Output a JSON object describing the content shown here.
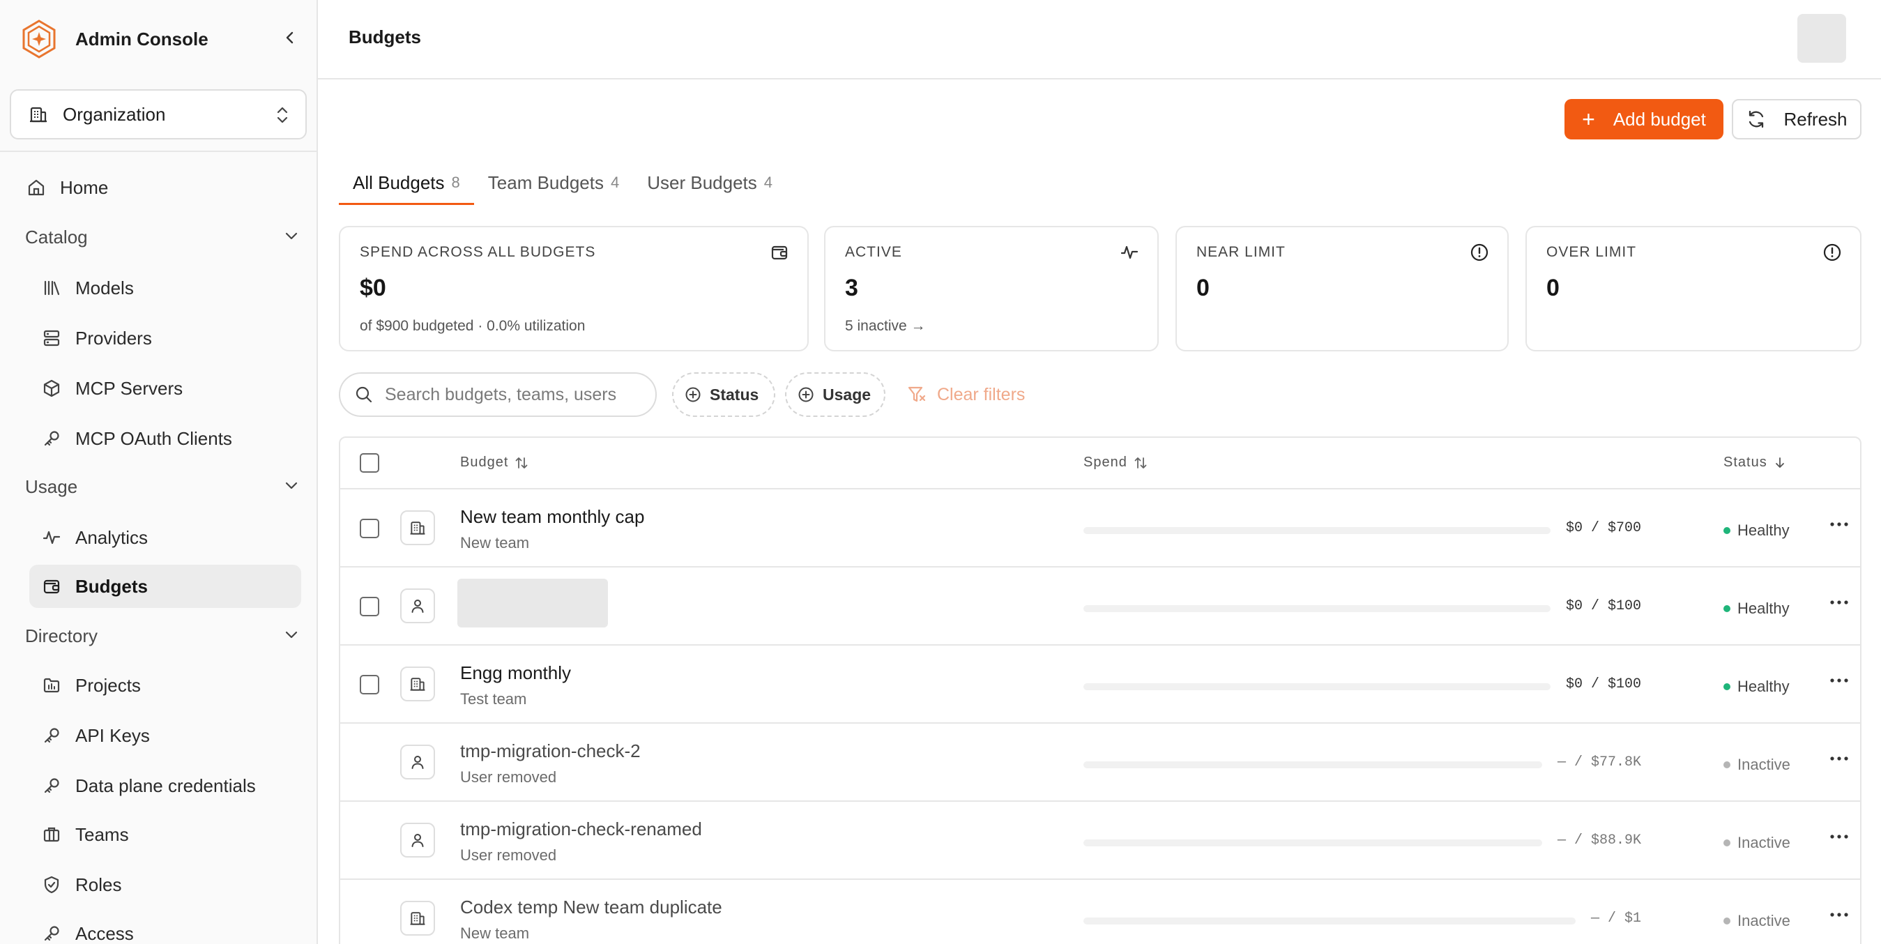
{
  "app": {
    "title": "Admin Console"
  },
  "org_switcher": {
    "label": "Organization"
  },
  "sidebar": {
    "home": "Home",
    "catalog": {
      "label": "Catalog",
      "items": [
        "Models",
        "Providers",
        "MCP Servers",
        "MCP OAuth Clients"
      ]
    },
    "usage": {
      "label": "Usage",
      "items": [
        "Analytics",
        "Budgets"
      ]
    },
    "directory": {
      "label": "Directory",
      "items": [
        "Projects",
        "API Keys",
        "Data plane credentials",
        "Teams",
        "Roles",
        "Access"
      ]
    },
    "active_item": "Budgets"
  },
  "header": {
    "page_title": "Budgets"
  },
  "actions": {
    "add_label": "Add budget",
    "refresh_label": "Refresh"
  },
  "tabs": [
    {
      "label": "All Budgets",
      "count": "8"
    },
    {
      "label": "Team Budgets",
      "count": "4"
    },
    {
      "label": "User Budgets",
      "count": "4"
    }
  ],
  "stats": {
    "spend": {
      "label": "SPEND ACROSS ALL BUDGETS",
      "value": "$0",
      "sub": "of $900 budgeted · 0.0% utilization"
    },
    "active": {
      "label": "ACTIVE",
      "value": "3",
      "sub": "5 inactive →"
    },
    "near": {
      "label": "NEAR LIMIT",
      "value": "0"
    },
    "over": {
      "label": "OVER LIMIT",
      "value": "0"
    }
  },
  "filters": {
    "search_placeholder": "Search budgets, teams, users",
    "status_label": "Status",
    "usage_label": "Usage",
    "clear_label": "Clear filters"
  },
  "table": {
    "columns": {
      "budget": "Budget",
      "spend": "Spend",
      "status": "Status"
    },
    "rows": [
      {
        "name": "New team monthly cap",
        "sub": "New team",
        "kind": "team",
        "spend": "$0 / $700",
        "usage": 0,
        "status": "Healthy"
      },
      {
        "name": "",
        "sub": "",
        "kind": "user",
        "spend": "$0 / $100",
        "usage": 0,
        "status": "Healthy",
        "loading": true
      },
      {
        "name": "Engg monthly",
        "sub": "Test team",
        "kind": "team",
        "spend": "$0 / $100",
        "usage": 0,
        "status": "Healthy"
      },
      {
        "name": "tmp-migration-check-2",
        "sub": "User removed",
        "kind": "user",
        "spend": "— / $77.8K",
        "usage": 0,
        "status": "Inactive"
      },
      {
        "name": "tmp-migration-check-renamed",
        "sub": "User removed",
        "kind": "user",
        "spend": "— / $88.9K",
        "usage": 0,
        "status": "Inactive"
      },
      {
        "name": "Codex temp New team duplicate",
        "sub": "New team",
        "kind": "team",
        "spend": "— / $1",
        "usage": 0,
        "status": "Inactive"
      }
    ]
  },
  "colors": {
    "accent": "#f25a12",
    "healthy": "#1fb57a",
    "inactive": "#b5b5b5"
  }
}
